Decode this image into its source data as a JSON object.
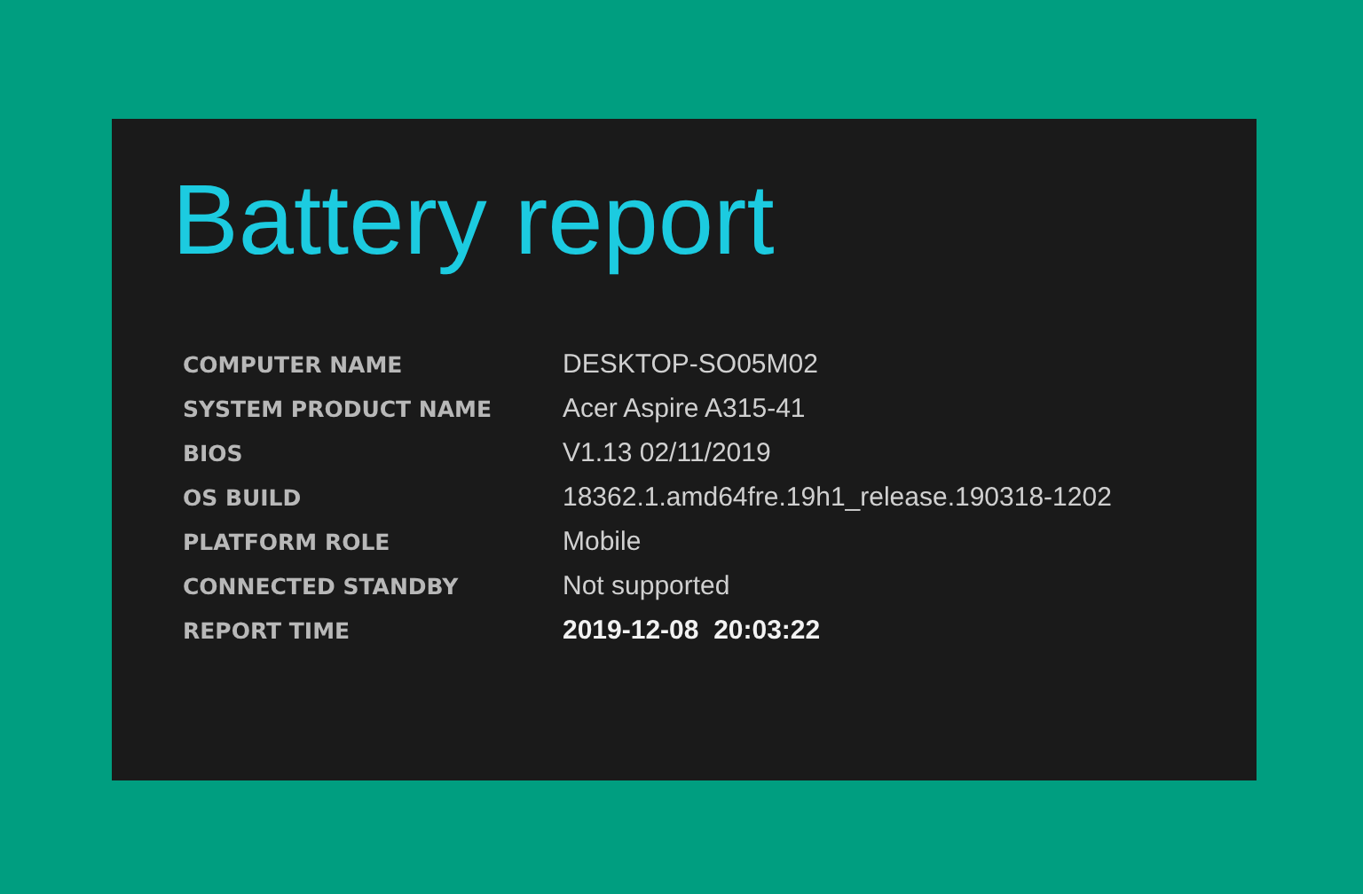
{
  "title": "Battery report",
  "rows": [
    {
      "label": "COMPUTER NAME",
      "value": "DESKTOP-SO05M02",
      "bold": false
    },
    {
      "label": "SYSTEM PRODUCT NAME",
      "value": "Acer Aspire A315-41",
      "bold": false
    },
    {
      "label": "BIOS",
      "value": "V1.13 02/11/2019",
      "bold": false
    },
    {
      "label": "OS BUILD",
      "value": "18362.1.amd64fre.19h1_release.190318-1202",
      "bold": false
    },
    {
      "label": "PLATFORM ROLE",
      "value": "Mobile",
      "bold": false
    },
    {
      "label": "CONNECTED STANDBY",
      "value": "Not supported",
      "bold": false
    },
    {
      "label": "REPORT TIME",
      "value": "2019-12-08  20:03:22",
      "bold": true
    }
  ]
}
